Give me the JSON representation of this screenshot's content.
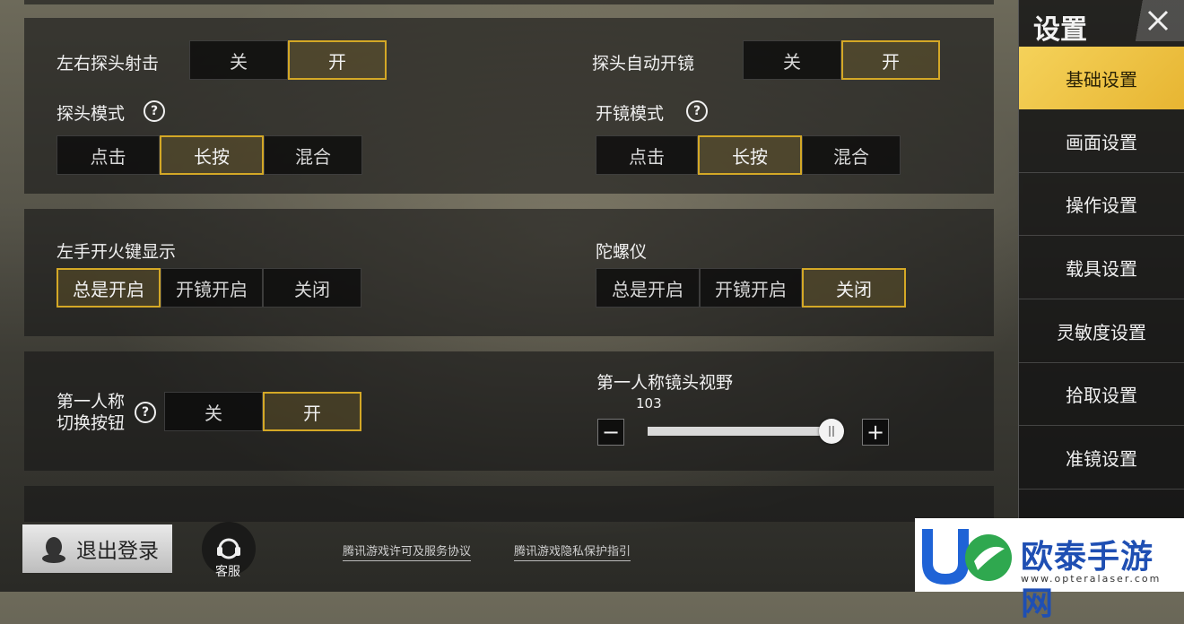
{
  "settings": {
    "lean_fire": {
      "label": "左右探头射击",
      "options": [
        "关",
        "开"
      ],
      "selected": "开"
    },
    "lean_auto_scope": {
      "label": "探头自动开镜",
      "options": [
        "关",
        "开"
      ],
      "selected": "开"
    },
    "lean_mode": {
      "label": "探头模式",
      "options": [
        "点击",
        "长按",
        "混合"
      ],
      "selected": "长按"
    },
    "scope_mode": {
      "label": "开镜模式",
      "options": [
        "点击",
        "长按",
        "混合"
      ],
      "selected": "长按"
    },
    "left_fire_display": {
      "label": "左手开火键显示",
      "options": [
        "总是开启",
        "开镜开启",
        "关闭"
      ],
      "selected": "总是开启"
    },
    "gyroscope": {
      "label": "陀螺仪",
      "options": [
        "总是开启",
        "开镜开启",
        "关闭"
      ],
      "selected": "关闭"
    },
    "fpp_toggle": {
      "label_line1": "第一人称",
      "label_line2": "切换按钮",
      "options": [
        "关",
        "开"
      ],
      "selected": "开"
    },
    "fpp_fov": {
      "label": "第一人称镜头视野",
      "value": "103",
      "min_label": "−",
      "max_label": "+",
      "fraction": 0.95
    }
  },
  "sidebar": {
    "title": "设置",
    "items": [
      {
        "label": "基础设置",
        "active": true
      },
      {
        "label": "画面设置",
        "active": false
      },
      {
        "label": "操作设置",
        "active": false
      },
      {
        "label": "载具设置",
        "active": false
      },
      {
        "label": "灵敏度设置",
        "active": false
      },
      {
        "label": "拾取设置",
        "active": false
      },
      {
        "label": "准镜设置",
        "active": false
      }
    ]
  },
  "footer": {
    "logout_label": "退出登录",
    "service_label": "客服",
    "license_link": "腾讯游戏许可及服务协议",
    "privacy_link": "腾讯游戏隐私保护指引"
  },
  "watermark": {
    "brand": "欧泰手游网",
    "url": "www.opteralaser.com"
  },
  "colors": {
    "accent": "#d4a826",
    "active_tab": "#f0c445"
  }
}
